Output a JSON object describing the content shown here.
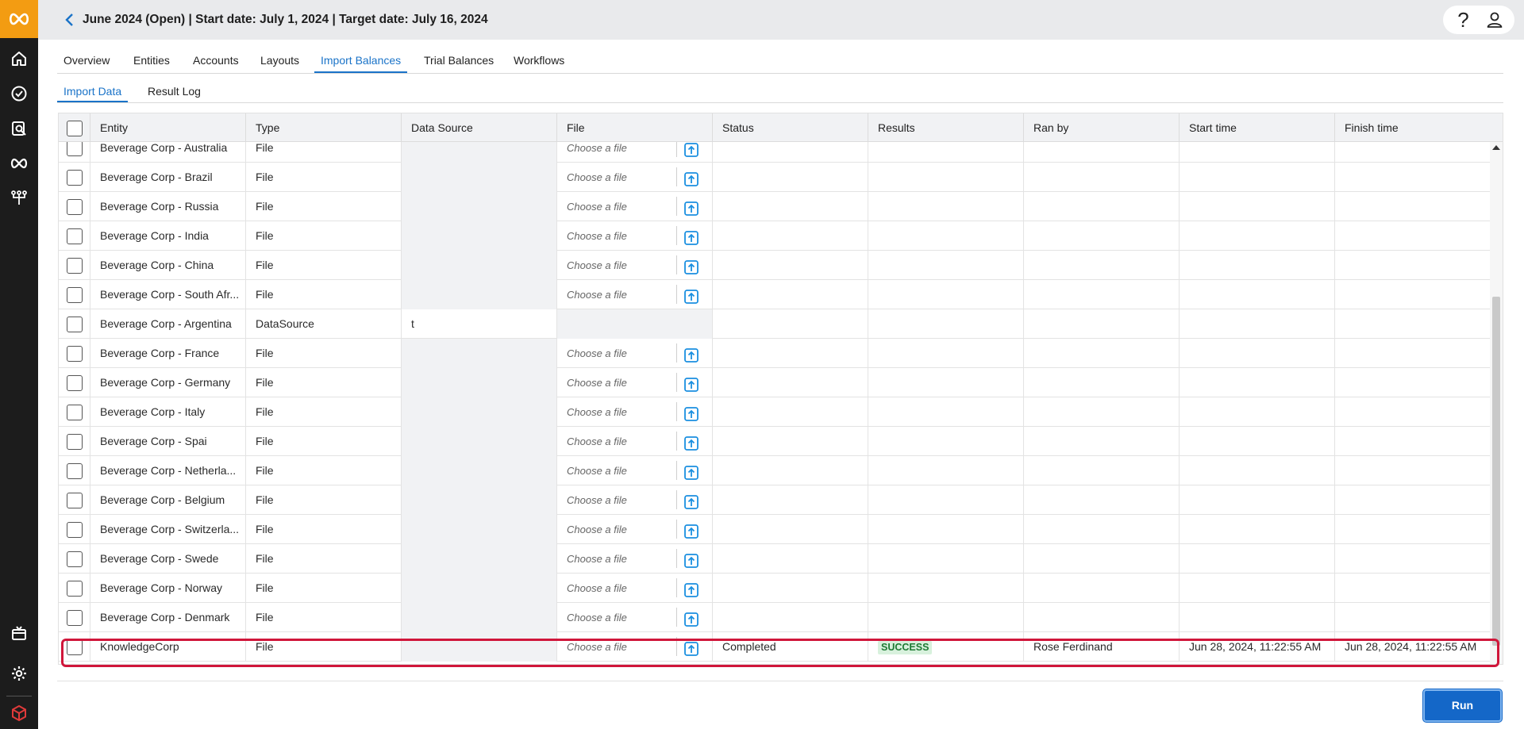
{
  "header": {
    "title": "June 2024 (Open) | Start date: July 1, 2024 | Target date: July 16, 2024",
    "help_label": "?"
  },
  "rail": {
    "icons": [
      "home-icon",
      "check-circle-icon",
      "search-doc-icon",
      "infinity-icon",
      "workflow-icon",
      "package-icon",
      "gear-icon",
      "cube-icon"
    ]
  },
  "tabs": {
    "main": [
      "Overview",
      "Entities",
      "Accounts",
      "Layouts",
      "Import Balances",
      "Trial Balances",
      "Workflows"
    ],
    "main_active": "Import Balances",
    "sub": [
      "Import Data",
      "Result Log"
    ],
    "sub_active": "Import Data"
  },
  "table": {
    "columns": [
      "Entity",
      "Type",
      "Data Source",
      "File",
      "Status",
      "Results",
      "Ran by",
      "Start time",
      "Finish time"
    ],
    "choose_placeholder": "Choose a file",
    "rows": [
      {
        "entity": "Beverage Corp - Australia",
        "type": "File",
        "data_source": "",
        "file": "Choose a file",
        "status": "",
        "results": "",
        "ran_by": "",
        "start": "",
        "finish": ""
      },
      {
        "entity": "Beverage Corp - Brazil",
        "type": "File",
        "data_source": "",
        "file": "Choose a file",
        "status": "",
        "results": "",
        "ran_by": "",
        "start": "",
        "finish": ""
      },
      {
        "entity": "Beverage Corp - Russia",
        "type": "File",
        "data_source": "",
        "file": "Choose a file",
        "status": "",
        "results": "",
        "ran_by": "",
        "start": "",
        "finish": ""
      },
      {
        "entity": "Beverage Corp - India",
        "type": "File",
        "data_source": "",
        "file": "Choose a file",
        "status": "",
        "results": "",
        "ran_by": "",
        "start": "",
        "finish": ""
      },
      {
        "entity": "Beverage Corp - China",
        "type": "File",
        "data_source": "",
        "file": "Choose a file",
        "status": "",
        "results": "",
        "ran_by": "",
        "start": "",
        "finish": ""
      },
      {
        "entity": "Beverage Corp - South Afr...",
        "type": "File",
        "data_source": "",
        "file": "Choose a file",
        "status": "",
        "results": "",
        "ran_by": "",
        "start": "",
        "finish": ""
      },
      {
        "entity": "Beverage Corp - Argentina",
        "type": "DataSource",
        "data_source": "t",
        "file": "",
        "status": "",
        "results": "",
        "ran_by": "",
        "start": "",
        "finish": ""
      },
      {
        "entity": "Beverage Corp - France",
        "type": "File",
        "data_source": "",
        "file": "Choose a file",
        "status": "",
        "results": "",
        "ran_by": "",
        "start": "",
        "finish": ""
      },
      {
        "entity": "Beverage Corp - Germany",
        "type": "File",
        "data_source": "",
        "file": "Choose a file",
        "status": "",
        "results": "",
        "ran_by": "",
        "start": "",
        "finish": ""
      },
      {
        "entity": "Beverage Corp - Italy",
        "type": "File",
        "data_source": "",
        "file": "Choose a file",
        "status": "",
        "results": "",
        "ran_by": "",
        "start": "",
        "finish": ""
      },
      {
        "entity": "Beverage Corp - Spai",
        "type": "File",
        "data_source": "",
        "file": "Choose a file",
        "status": "",
        "results": "",
        "ran_by": "",
        "start": "",
        "finish": ""
      },
      {
        "entity": "Beverage Corp - Netherla...",
        "type": "File",
        "data_source": "",
        "file": "Choose a file",
        "status": "",
        "results": "",
        "ran_by": "",
        "start": "",
        "finish": ""
      },
      {
        "entity": "Beverage Corp - Belgium",
        "type": "File",
        "data_source": "",
        "file": "Choose a file",
        "status": "",
        "results": "",
        "ran_by": "",
        "start": "",
        "finish": ""
      },
      {
        "entity": "Beverage Corp - Switzerla...",
        "type": "File",
        "data_source": "",
        "file": "Choose a file",
        "status": "",
        "results": "",
        "ran_by": "",
        "start": "",
        "finish": ""
      },
      {
        "entity": "Beverage Corp - Swede",
        "type": "File",
        "data_source": "",
        "file": "Choose a file",
        "status": "",
        "results": "",
        "ran_by": "",
        "start": "",
        "finish": ""
      },
      {
        "entity": "Beverage Corp - Norway",
        "type": "File",
        "data_source": "",
        "file": "Choose a file",
        "status": "",
        "results": "",
        "ran_by": "",
        "start": "",
        "finish": ""
      },
      {
        "entity": "Beverage Corp - Denmark",
        "type": "File",
        "data_source": "",
        "file": "Choose a file",
        "status": "",
        "results": "",
        "ran_by": "",
        "start": "",
        "finish": ""
      },
      {
        "entity": "KnowledgeCorp",
        "type": "File",
        "data_source": "",
        "file": "Choose a file",
        "status": "Completed",
        "results": "SUCCESS",
        "ran_by": "Rose Ferdinand",
        "start": "Jun 28, 2024, 11:22:55 AM",
        "finish": "Jun 28, 2024, 11:22:55 AM",
        "highlighted": true
      }
    ]
  },
  "footer": {
    "run_label": "Run"
  },
  "colors": {
    "accent": "#1a73c8",
    "brand": "#f39c12",
    "success_bg": "#d8f1dd",
    "success_text": "#1e7a33",
    "highlight": "#d0163a"
  }
}
